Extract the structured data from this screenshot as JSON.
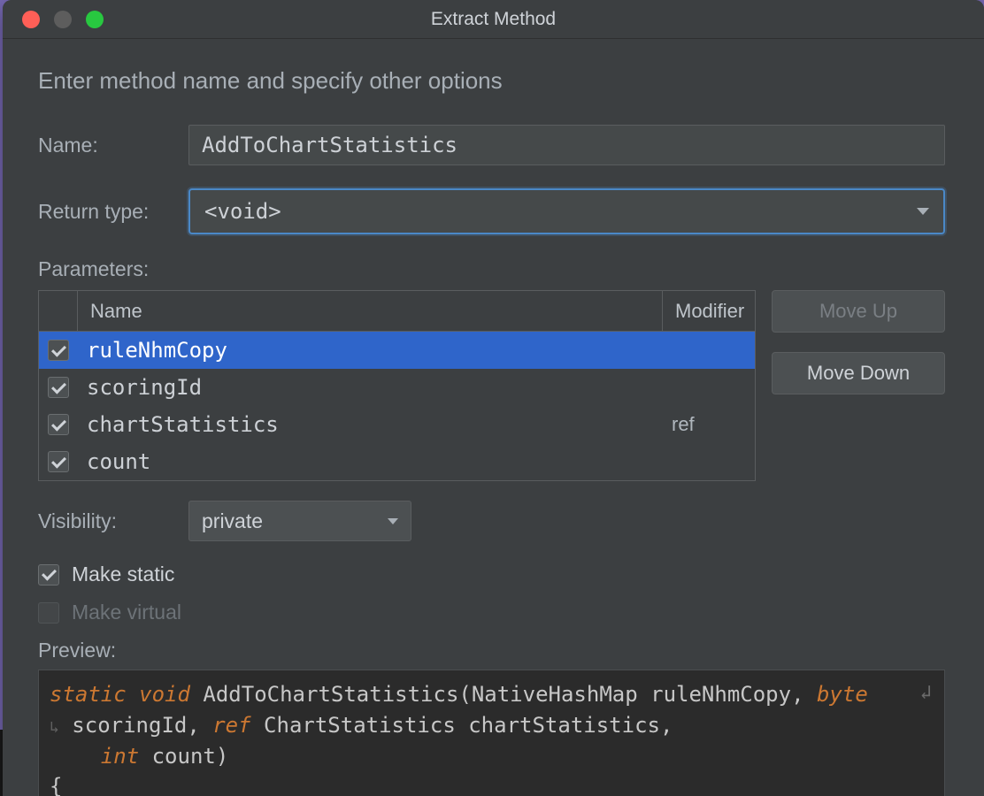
{
  "window": {
    "title": "Extract Method"
  },
  "prompt": "Enter method name and specify other options",
  "labels": {
    "name": "Name:",
    "returnType": "Return type:",
    "parameters": "Parameters:",
    "visibility": "Visibility:",
    "preview": "Preview:",
    "paramName": "Name",
    "paramModifier": "Modifier"
  },
  "fields": {
    "name": "AddToChartStatistics",
    "returnType": "<void>",
    "visibility": "private"
  },
  "parameters": [
    {
      "checked": true,
      "name": "ruleNhmCopy",
      "modifier": "",
      "selected": true
    },
    {
      "checked": true,
      "name": "scoringId",
      "modifier": "",
      "selected": false
    },
    {
      "checked": true,
      "name": "chartStatistics",
      "modifier": "ref",
      "selected": false
    },
    {
      "checked": true,
      "name": "count",
      "modifier": "",
      "selected": false
    }
  ],
  "buttons": {
    "moveUp": "Move Up",
    "moveDown": "Move Down"
  },
  "options": {
    "makeStatic": {
      "label": "Make static",
      "checked": true,
      "enabled": true
    },
    "makeVirtual": {
      "label": "Make virtual",
      "checked": false,
      "enabled": false
    }
  },
  "preview": {
    "line1_kw1": "static",
    "line1_kw2": "void",
    "line1_rest": " AddToChartStatistics(NativeHashMap ruleNhmCopy, ",
    "line1_kw3": "byte",
    "line2_pre": " scoringId, ",
    "line2_kw": "ref",
    "line2_rest": " ChartStatistics chartStatistics,",
    "line3_kw": "int",
    "line3_rest": " count)",
    "line4": "{"
  }
}
